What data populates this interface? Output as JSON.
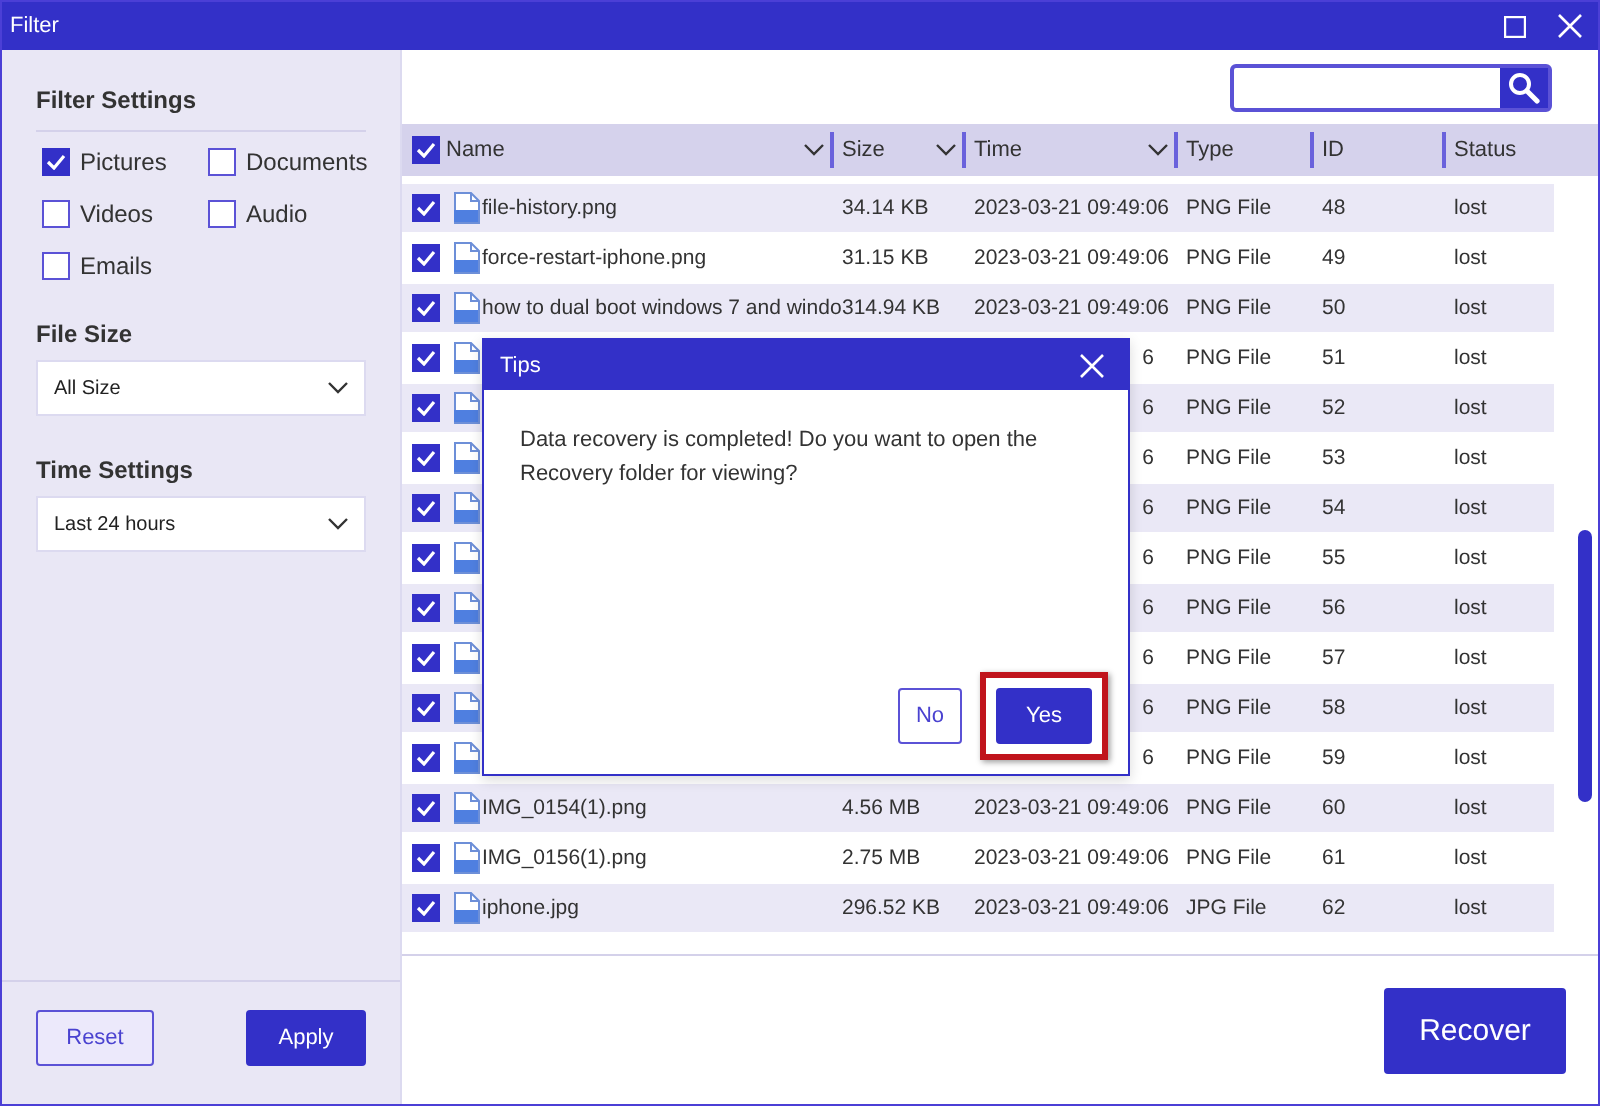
{
  "window": {
    "title": "Filter"
  },
  "sidebar": {
    "heading": "Filter Settings",
    "types": [
      {
        "label": "Pictures",
        "checked": true
      },
      {
        "label": "Documents",
        "checked": false
      },
      {
        "label": "Videos",
        "checked": false
      },
      {
        "label": "Audio",
        "checked": false
      },
      {
        "label": "Emails",
        "checked": false
      }
    ],
    "file_size": {
      "label": "File Size",
      "value": "All Size"
    },
    "time_settings": {
      "label": "Time Settings",
      "value": "Last 24 hours"
    },
    "buttons": [
      {
        "label": "Reset",
        "primary": false
      },
      {
        "label": "Apply",
        "primary": true
      }
    ]
  },
  "table": {
    "all_checked": true,
    "columns": [
      {
        "label": "Name",
        "sortable": true
      },
      {
        "label": "Size",
        "sortable": true
      },
      {
        "label": "Time",
        "sortable": true
      },
      {
        "label": "Type",
        "sortable": false
      },
      {
        "label": "ID",
        "sortable": false
      },
      {
        "label": "Status",
        "sortable": false
      }
    ],
    "rows": [
      {
        "checked": true,
        "name": "file-history.png",
        "size": "34.14 KB",
        "time": "2023-03-21 09:49:06",
        "type": "PNG File",
        "id": "48",
        "status": "lost"
      },
      {
        "checked": true,
        "name": "force-restart-iphone.png",
        "size": "31.15 KB",
        "time": "2023-03-21 09:49:06",
        "type": "PNG File",
        "id": "49",
        "status": "lost"
      },
      {
        "checked": true,
        "name": "how to dual boot windows 7 and windo",
        "size": "314.94 KB",
        "time": "2023-03-21 09:49:06",
        "type": "PNG File",
        "id": "50",
        "status": "lost"
      },
      {
        "checked": true,
        "time_tail": "6",
        "type": "PNG File",
        "id": "51",
        "status": "lost"
      },
      {
        "checked": true,
        "time_tail": "6",
        "type": "PNG File",
        "id": "52",
        "status": "lost"
      },
      {
        "checked": true,
        "time_tail": "6",
        "type": "PNG File",
        "id": "53",
        "status": "lost"
      },
      {
        "checked": true,
        "time_tail": "6",
        "type": "PNG File",
        "id": "54",
        "status": "lost"
      },
      {
        "checked": true,
        "time_tail": "6",
        "type": "PNG File",
        "id": "55",
        "status": "lost"
      },
      {
        "checked": true,
        "time_tail": "6",
        "type": "PNG File",
        "id": "56",
        "status": "lost"
      },
      {
        "checked": true,
        "time_tail": "6",
        "type": "PNG File",
        "id": "57",
        "status": "lost"
      },
      {
        "checked": true,
        "time_tail": "6",
        "type": "PNG File",
        "id": "58",
        "status": "lost"
      },
      {
        "checked": true,
        "time_tail": "6",
        "type": "PNG File",
        "id": "59",
        "status": "lost"
      },
      {
        "checked": true,
        "name": "IMG_0154(1).png",
        "size": "4.56 MB",
        "time": "2023-03-21 09:49:06",
        "type": "PNG File",
        "id": "60",
        "status": "lost"
      },
      {
        "checked": true,
        "name": "IMG_0156(1).png",
        "size": "2.75 MB",
        "time": "2023-03-21 09:49:06",
        "type": "PNG File",
        "id": "61",
        "status": "lost"
      },
      {
        "checked": true,
        "name": "iphone.jpg",
        "size": "296.52 KB",
        "time": "2023-03-21 09:49:06",
        "type": "JPG File",
        "id": "62",
        "status": "lost"
      }
    ]
  },
  "recover_button": "Recover",
  "dialog": {
    "title": "Tips",
    "message": "Data recovery is completed! Do you want to open the Recovery folder for viewing?",
    "buttons": [
      {
        "label": "No",
        "primary": false,
        "highlighted": false
      },
      {
        "label": "Yes",
        "primary": true,
        "highlighted": true
      }
    ]
  }
}
